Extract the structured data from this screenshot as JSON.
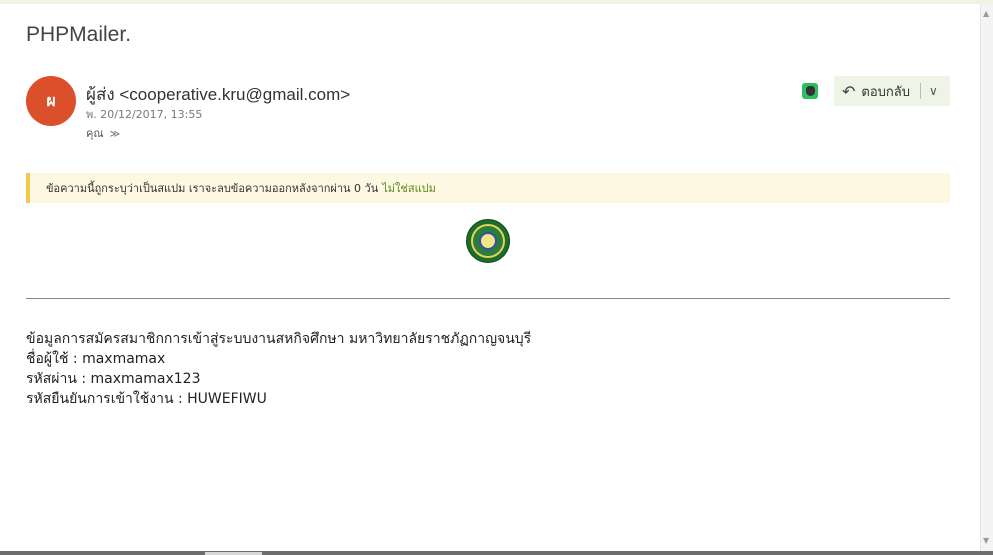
{
  "message": {
    "subject": "PHPMailer.",
    "sender_initial": "ผ",
    "sender_display": "ผู้ส่ง <cooperative.kru@gmail.com>",
    "date": "พ. 20/12/2017, 13:55",
    "to_label": "คุณ",
    "to_chevron": "≫"
  },
  "actions": {
    "reply_label": "ตอบกลับ",
    "reply_icon": "reply-icon",
    "more_icon": "chevron-down-icon",
    "evernote_icon": "evernote-icon"
  },
  "spam": {
    "notice": "ข้อความนี้ถูกระบุว่าเป็นสแปม เราจะลบข้อความออกหลังจากผ่าน 0 วัน",
    "not_spam_link": "ไม่ใช่สแปม"
  },
  "body": {
    "lines": [
      "ข้อมูลการสมัครสมาชิกการเข้าสู่ระบบงานสหกิจศึกษา มหาวิทยาลัยราชภัฏกาญจนบุรี",
      "ชื่อผู้ใช้ : maxmamax",
      "รหัสผ่าน : maxmamax123",
      "รหัสยืนยันการเข้าใช้งาน : HUWEFIWU"
    ]
  },
  "colors": {
    "avatar": "#dc4f2b",
    "spam_banner": "#fdf8e2",
    "spam_accent": "#f2c94c",
    "link": "#5b8a1c"
  }
}
